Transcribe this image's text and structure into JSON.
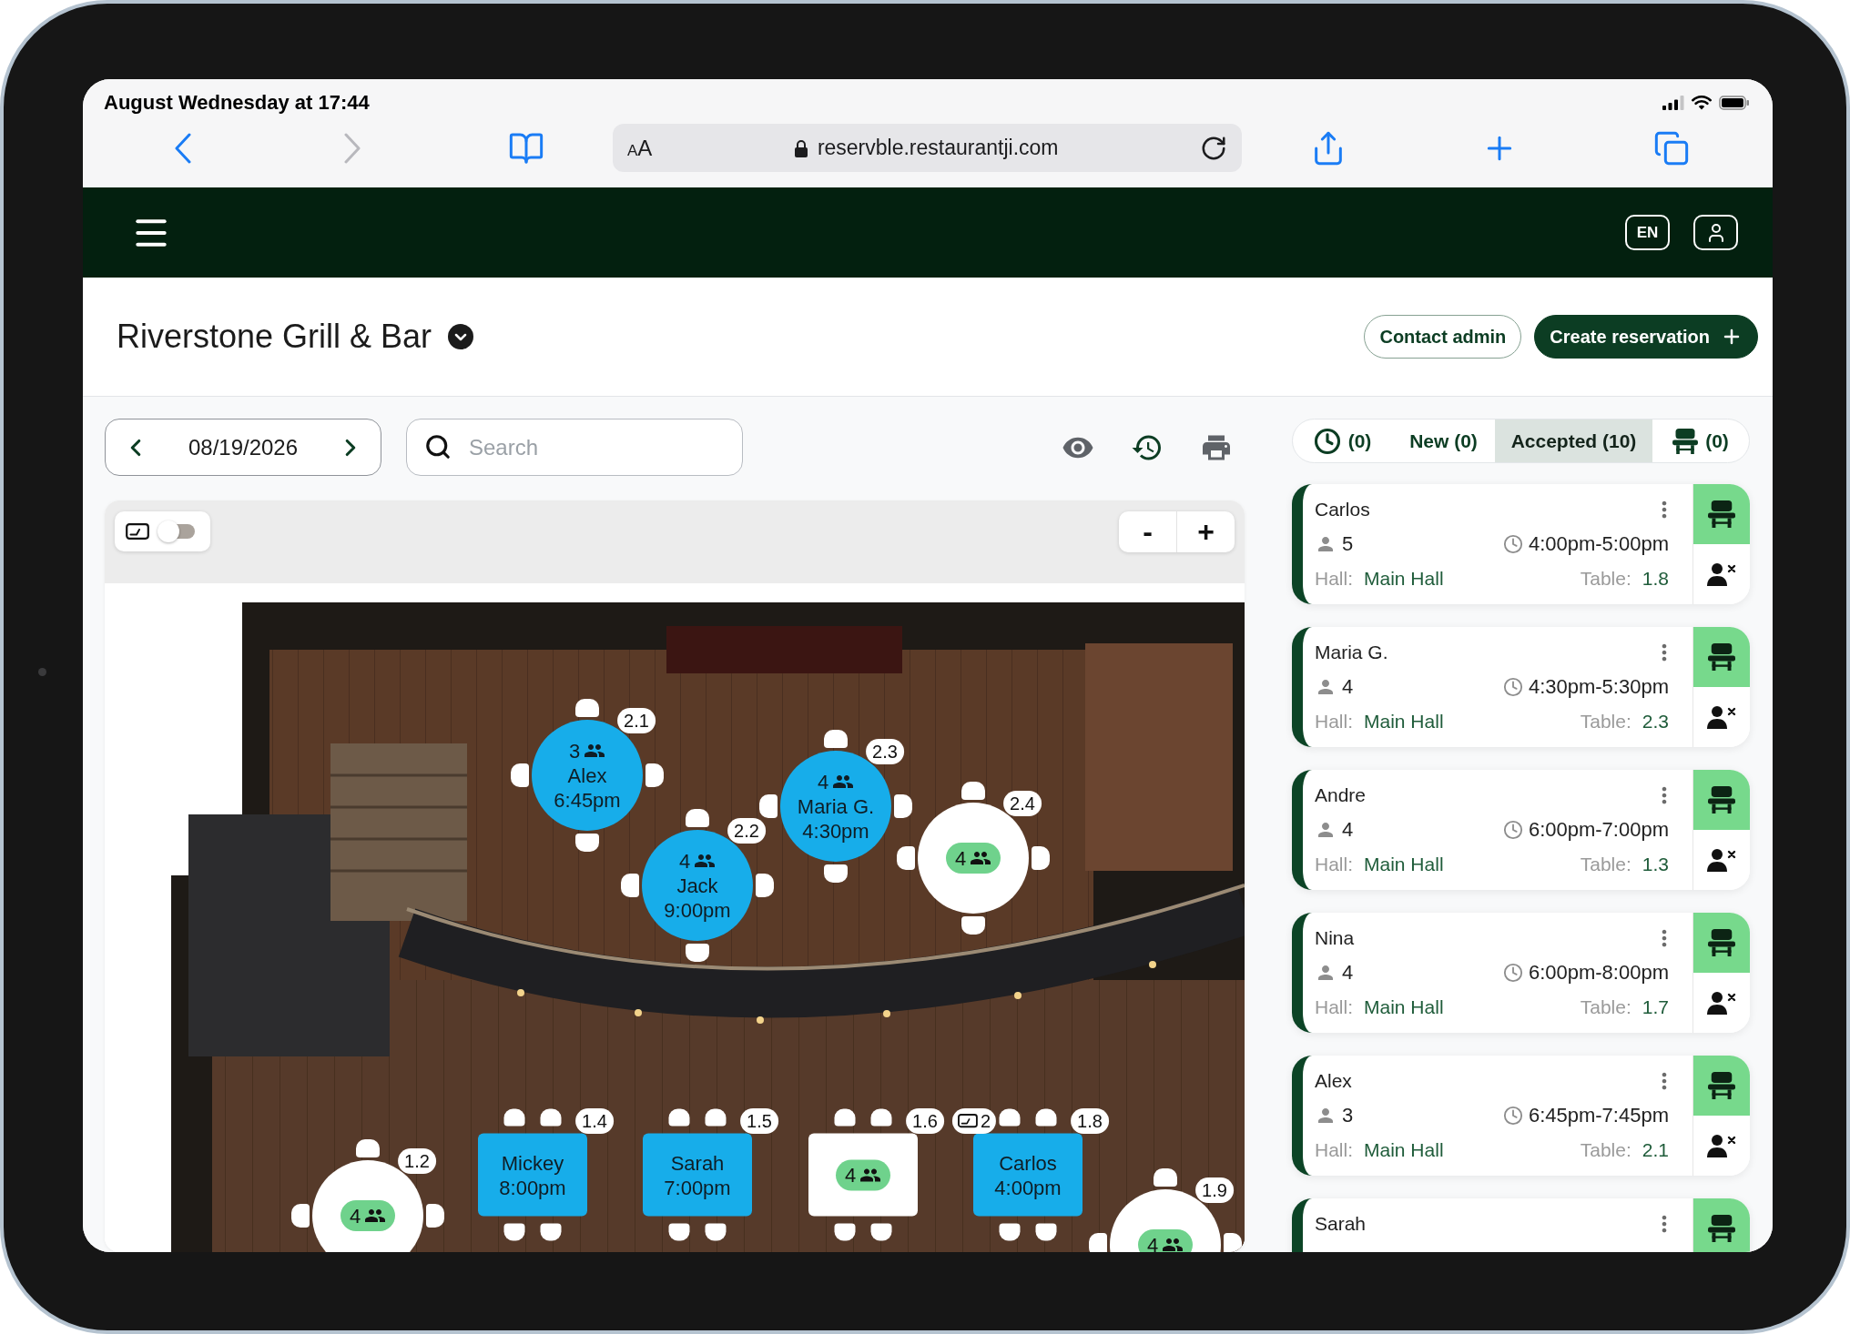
{
  "status_bar": {
    "time": "August Wednesday at 17:44"
  },
  "browser": {
    "text_size_button": "AA",
    "url": "reservble.restaurantji.com"
  },
  "app_bar": {
    "language": "EN"
  },
  "page_header": {
    "title": "Riverstone Grill & Bar",
    "buttons": [
      {
        "kind": "outline",
        "label": "Contact admin"
      },
      {
        "kind": "primary",
        "label": "Create reservation"
      }
    ]
  },
  "filters": {
    "date": "08/19/2026",
    "search": {
      "placeholder": "Search"
    }
  },
  "floor_plan": {
    "toggle": {
      "on": false
    },
    "zoom_buttons": [
      "-",
      "+"
    ],
    "tables": [
      {
        "number": "2.1",
        "kind": "round",
        "reserved": true,
        "guests": "3",
        "name": "Alex",
        "time": "6:45pm"
      },
      {
        "number": "2.2",
        "kind": "round",
        "reserved": true,
        "guests": "4",
        "name": "Jack",
        "time": "9:00pm"
      },
      {
        "number": "2.3",
        "kind": "round",
        "reserved": true,
        "guests": "4",
        "name": "Maria G.",
        "time": "4:30pm"
      },
      {
        "number": "2.4",
        "kind": "round",
        "reserved": false,
        "seats": "4"
      },
      {
        "number": "1.2",
        "kind": "round",
        "reserved": false,
        "seats": "4"
      },
      {
        "number": "1.4",
        "kind": "rect",
        "reserved": true,
        "name": "Mickey",
        "time": "8:00pm"
      },
      {
        "number": "1.5",
        "kind": "rect",
        "reserved": true,
        "name": "Sarah",
        "time": "7:00pm"
      },
      {
        "number": "1.6",
        "kind": "rect",
        "reserved": false,
        "seats": "4"
      },
      {
        "number": "1.8",
        "kind": "rect",
        "reserved": true,
        "name": "Carlos",
        "time": "4:00pm",
        "badge": "2"
      },
      {
        "number": "1.9",
        "kind": "round",
        "reserved": false,
        "seats": "4"
      }
    ]
  },
  "reservation_tabs": [
    {
      "kind": "waiting",
      "label": "(0)",
      "selected": false
    },
    {
      "kind": "plain",
      "label": "New (0)",
      "selected": false
    },
    {
      "kind": "plain",
      "label": "Accepted (10)",
      "selected": true
    },
    {
      "kind": "seated",
      "label": "(0)",
      "selected": false
    }
  ],
  "reservations": [
    {
      "name": "Carlos",
      "guests": "5",
      "time": "4:00pm-5:00pm",
      "hall_label": "Hall:",
      "hall": "Main Hall",
      "table_label": "Table:",
      "table": "1.8"
    },
    {
      "name": "Maria G.",
      "guests": "4",
      "time": "4:30pm-5:30pm",
      "hall_label": "Hall:",
      "hall": "Main Hall",
      "table_label": "Table:",
      "table": "2.3"
    },
    {
      "name": "Andre",
      "guests": "4",
      "time": "6:00pm-7:00pm",
      "hall_label": "Hall:",
      "hall": "Main Hall",
      "table_label": "Table:",
      "table": "1.3"
    },
    {
      "name": "Nina",
      "guests": "4",
      "time": "6:00pm-8:00pm",
      "hall_label": "Hall:",
      "hall": "Main Hall",
      "table_label": "Table:",
      "table": "1.7"
    },
    {
      "name": "Alex",
      "guests": "3",
      "time": "6:45pm-7:45pm",
      "hall_label": "Hall:",
      "hall": "Main Hall",
      "table_label": "Table:",
      "table": "2.1"
    },
    {
      "name": "Sarah"
    }
  ]
}
